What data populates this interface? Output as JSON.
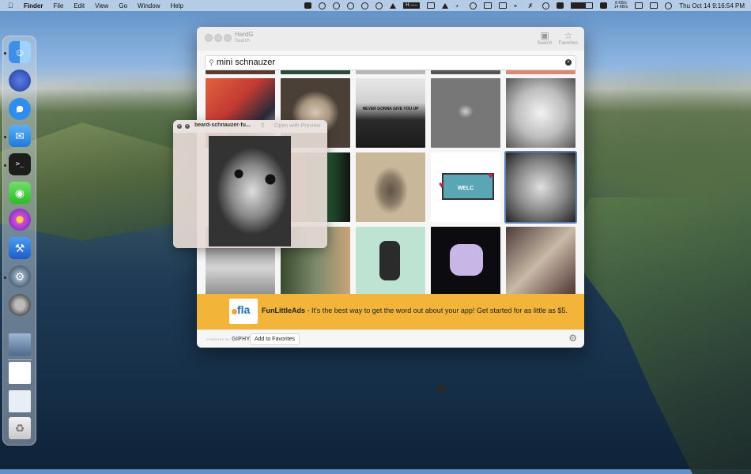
{
  "menubar": {
    "app_name": "Finder",
    "menus": [
      "File",
      "Edit",
      "View",
      "Go",
      "Window",
      "Help"
    ],
    "net_speed_up": "8 KB/s",
    "net_speed_down": "14 KB/s",
    "clock": "Thu Oct 14  9:16:54 PM"
  },
  "window": {
    "title": "HardG",
    "subtitle": "Search",
    "toolbar": {
      "search_label": "Search",
      "favorites_label": "Favorites"
    },
    "search": {
      "value": "mini schnauzer"
    },
    "gif_captions": {
      "rick": "NEVER GONNA GIVE YOU UP",
      "welcome_sign": "WELC"
    },
    "ad": {
      "logo_text": "fla",
      "brand": "FunLittleAds",
      "text": " - It's the best way to get the word out about your app! Get started for as little as $5."
    },
    "footer": {
      "powered_by": "POWERED BY",
      "giphy": "GIPHY",
      "add_favorites": "Add to Favorites"
    }
  },
  "preview": {
    "filename": "beard-schnauzer-fu...",
    "open_with": "Open with Preview"
  },
  "colors": {
    "ad_background": "#f2b53a",
    "selection": "#5b7fb3",
    "logo_blue": "#1f6fb8"
  }
}
